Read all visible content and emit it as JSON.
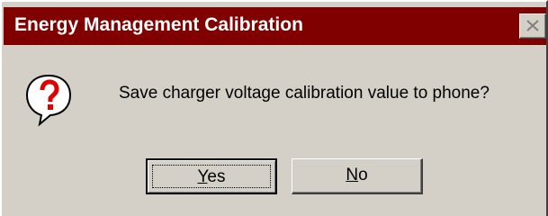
{
  "window": {
    "title": "Energy Management Calibration",
    "titlebar_color": "#800000",
    "close_icon": "close-x-icon"
  },
  "dialog": {
    "icon": "question-icon",
    "message": "Save charger voltage calibration value to phone?"
  },
  "buttons": {
    "yes": {
      "first_letter": "Y",
      "rest": "es",
      "focused": true
    },
    "no": {
      "first_letter": "N",
      "rest": "o"
    }
  }
}
